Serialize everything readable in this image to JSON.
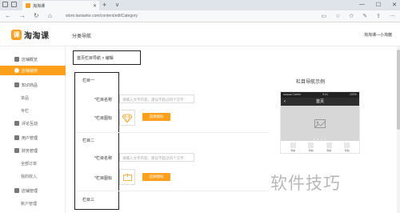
{
  "browser": {
    "tab_title": "淘淘课",
    "tab_close": "✕",
    "new_tab": "+",
    "tab_list": "∨",
    "url": "store.taotaoke.com/content/editCategory",
    "back": "←",
    "forward": "→",
    "refresh": "↻",
    "home": "⌂",
    "minimize": "—",
    "maximize": "☐",
    "close": "✕"
  },
  "header": {
    "logo_badge": "课",
    "logo_text": "淘淘课",
    "section_title": "分类导航",
    "store_name": "淘淘课—小淘酱"
  },
  "sidebar": {
    "items": [
      {
        "label": "店铺概览"
      },
      {
        "label": "店铺装修"
      },
      {
        "label": "知识商品"
      },
      {
        "label": "单品"
      },
      {
        "label": "专栏"
      },
      {
        "label": "评论互动"
      },
      {
        "label": "用户管理"
      },
      {
        "label": "财务管理"
      },
      {
        "label": "全部订单"
      },
      {
        "label": "我的收入"
      },
      {
        "label": "店铺管理"
      },
      {
        "label": "账户管理"
      }
    ]
  },
  "breadcrumb": "首页栏目导航 > 编辑",
  "form": {
    "sections": [
      {
        "title": "栏目一",
        "name_label": "*栏目名称",
        "name_placeholder": "请输入文字内容，建议不超过四个汉字",
        "icon_label": "*栏目图标",
        "select_button": "选择图标"
      },
      {
        "title": "栏目二",
        "name_label": "*栏目名称",
        "name_placeholder": "请输入文字内容，建议不超过四个汉字",
        "icon_label": "*栏目图标",
        "select_button": "选择图标"
      },
      {
        "title": "栏目三"
      }
    ]
  },
  "preview": {
    "title": "栏目导航示例",
    "status_left": "●●●●● Carrier",
    "status_time": "9:41",
    "status_right": "100%",
    "back_arrow": "‹",
    "nav_title": "首页",
    "dots": "● ● ● ●",
    "categories": [
      "导航",
      "导航",
      "导航",
      "导航"
    ]
  },
  "watermark": "软件技巧",
  "colors": {
    "accent": "#ff9f1a"
  }
}
